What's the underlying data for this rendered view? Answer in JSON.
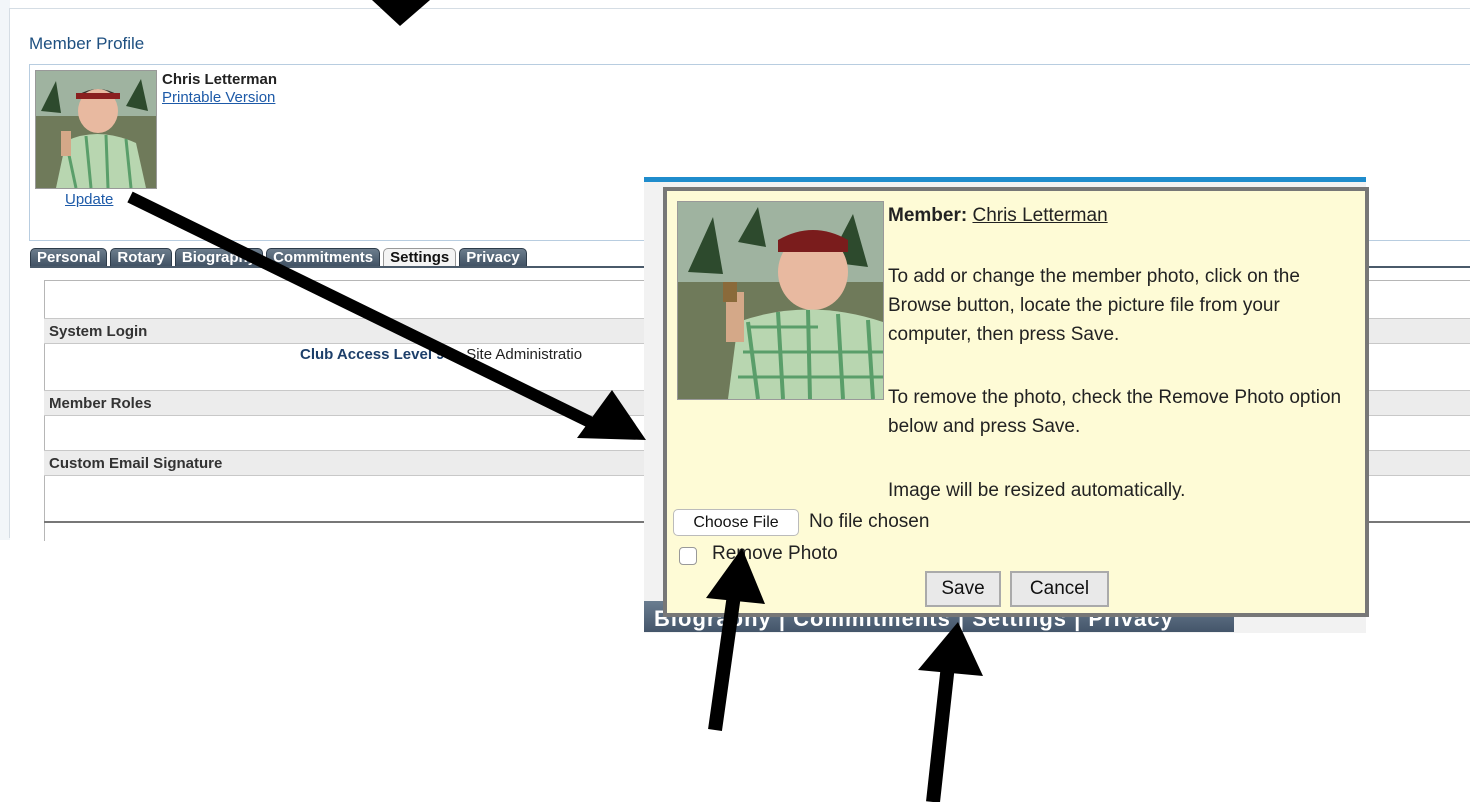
{
  "profile": {
    "title": "Member Profile",
    "member_name": "Chris Letterman",
    "printable_link": "Printable Version",
    "update_link": "Update"
  },
  "tabs": [
    {
      "label": "Personal",
      "active": false
    },
    {
      "label": "Rotary",
      "active": false
    },
    {
      "label": "Biography",
      "active": false
    },
    {
      "label": "Commitments",
      "active": false
    },
    {
      "label": "Settings",
      "active": true
    },
    {
      "label": "Privacy",
      "active": false
    }
  ],
  "settings": {
    "system_login": "System Login",
    "access_bold": "Club Access Level 90",
    "access_plain": " - Site Administratio",
    "member_roles": "Member Roles",
    "custom_email_signature": "Custom Email Signature"
  },
  "background_tabs": "Biography | Commitments | Settings | Privacy",
  "modal": {
    "member_label": "Member:",
    "member_name": "Chris Letterman",
    "instructions_1": "To add or change the member photo, click on the Browse button, locate the picture file from your computer, then press Save.",
    "instructions_2": "To remove the photo, check the Remove Photo option below and press Save.",
    "instructions_3": "Image will be resized automatically.",
    "choose_file": "Choose File",
    "no_file": "No file chosen",
    "remove_photo": "Remove Photo",
    "save": "Save",
    "cancel": "Cancel"
  },
  "colors": {
    "accent_blue": "#1f8ccc",
    "link_blue": "#1d5aa8",
    "modal_bg": "#fefbd6"
  }
}
